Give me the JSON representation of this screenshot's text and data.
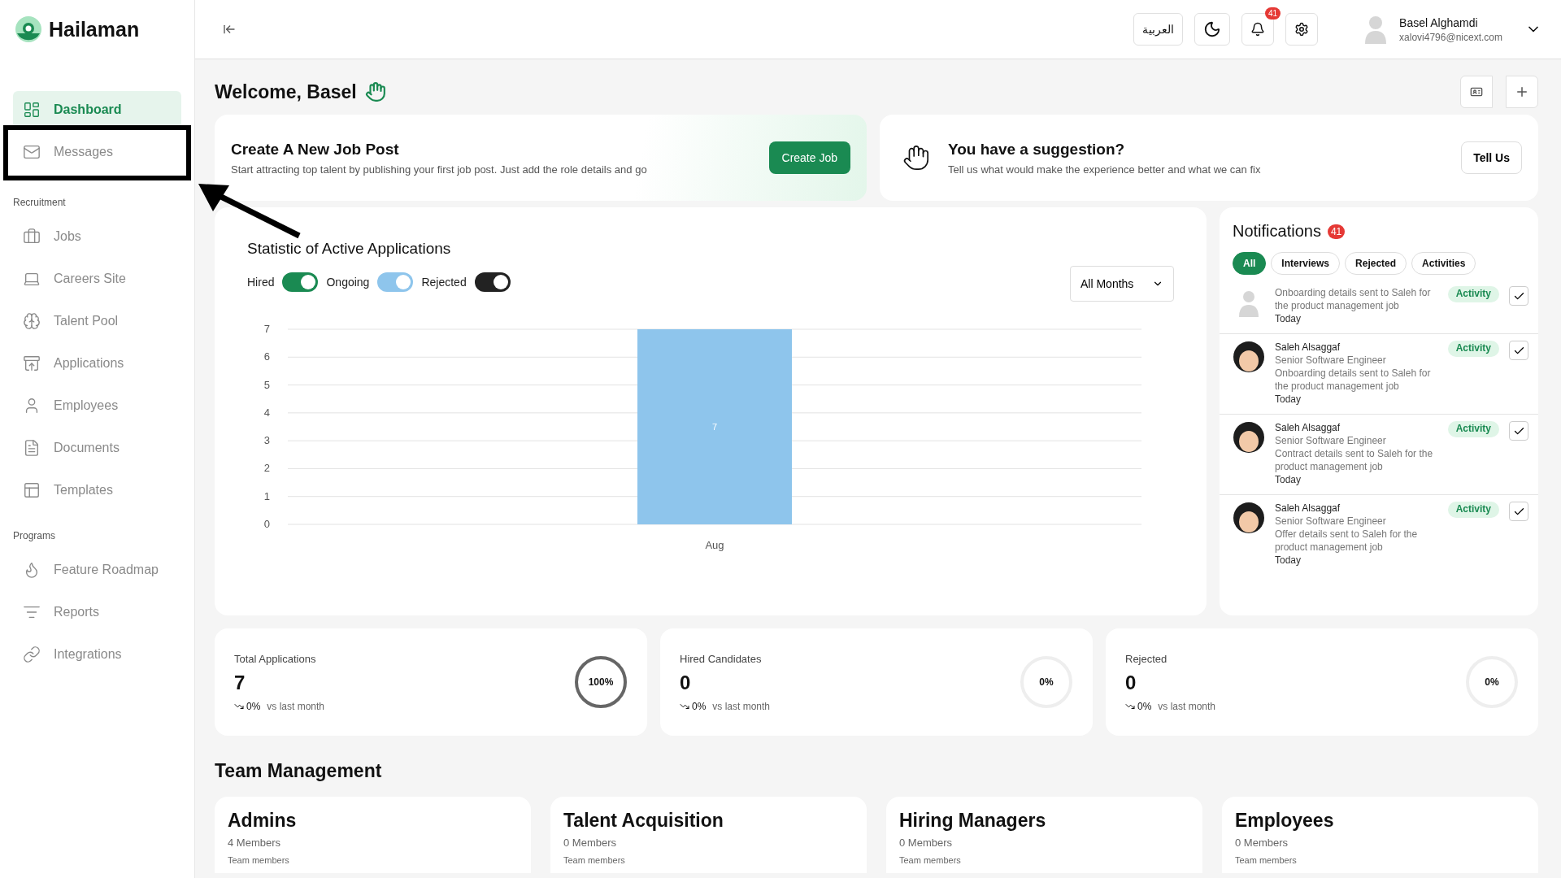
{
  "brand": {
    "name": "Hailaman"
  },
  "sidebar": {
    "sections": [
      {
        "items": [
          {
            "label": "Dashboard",
            "selected": true,
            "highlighted": false
          },
          {
            "label": "Messages",
            "selected": false,
            "highlighted": true
          }
        ]
      },
      {
        "title": "Recruitment",
        "items": [
          {
            "label": "Jobs",
            "selected": false,
            "highlighted": false
          },
          {
            "label": "Careers Site",
            "selected": false,
            "highlighted": false
          },
          {
            "label": "Talent Pool",
            "selected": false,
            "highlighted": false
          },
          {
            "label": "Applications",
            "selected": false,
            "highlighted": false
          },
          {
            "label": "Employees",
            "selected": false,
            "highlighted": false
          },
          {
            "label": "Documents",
            "selected": false,
            "highlighted": false
          },
          {
            "label": "Templates",
            "selected": false,
            "highlighted": false
          }
        ]
      },
      {
        "title": "Programs",
        "items": [
          {
            "label": "Feature Roadmap",
            "selected": false,
            "highlighted": false
          },
          {
            "label": "Reports",
            "selected": false,
            "highlighted": false
          },
          {
            "label": "Integrations",
            "selected": false,
            "highlighted": false
          }
        ]
      }
    ]
  },
  "topbar": {
    "language": "العربية",
    "notification_count": "41",
    "user": {
      "name": "Basel Alghamdi",
      "email": "xalovi4796@nicext.com"
    }
  },
  "welcome": "Welcome, Basel",
  "job_post": {
    "title": "Create A New Job Post",
    "text": "Start attracting top talent by publishing your first job post. Just add the role details and go",
    "button": "Create Job"
  },
  "suggestion": {
    "title": "You have a suggestion?",
    "text": "Tell us what would make the experience better and what we can fix",
    "button": "Tell Us"
  },
  "statistics": {
    "title": "Statistic of Active Applications",
    "toggles": [
      {
        "label": "Hired",
        "on": true,
        "color": "#1a8a52"
      },
      {
        "label": "Ongoing",
        "on": true,
        "color": "#8ec5ec"
      },
      {
        "label": "Rejected",
        "on": true,
        "color": "#222222"
      }
    ],
    "period": "All Months",
    "chart_data": {
      "type": "bar",
      "categories": [
        "Aug"
      ],
      "series": [
        {
          "color": "#8ec5ec",
          "values": [
            7
          ]
        }
      ],
      "ylim": [
        0,
        7
      ],
      "yticks": [
        0,
        1,
        2,
        3,
        4,
        5,
        6,
        7
      ],
      "grid": true,
      "data_labels": true
    }
  },
  "notifications": {
    "title": "Notifications",
    "count": "41",
    "filters": [
      {
        "label": "All",
        "selected": true
      },
      {
        "label": "Interviews",
        "selected": false
      },
      {
        "label": "Rejected",
        "selected": false
      },
      {
        "label": "Activities",
        "selected": false
      }
    ],
    "items": [
      {
        "kind": "placeholder",
        "text": "Onboarding details sent to Saleh for the product management job",
        "time": "Today",
        "tag": "Activity"
      },
      {
        "kind": "person",
        "name": "Saleh Alsaggaf",
        "role": "Senior Software Engineer",
        "text": "Onboarding details sent to Saleh for the product management job",
        "time": "Today",
        "tag": "Activity"
      },
      {
        "kind": "person",
        "name": "Saleh Alsaggaf",
        "role": "Senior Software Engineer",
        "text": "Contract details sent to Saleh for the product management job",
        "time": "Today",
        "tag": "Activity"
      },
      {
        "kind": "person",
        "name": "Saleh Alsaggaf",
        "role": "Senior Software Engineer",
        "text": "Offer details sent to Saleh for the product management job",
        "time": "Today",
        "tag": "Activity"
      }
    ]
  },
  "stats": [
    {
      "label": "Total Applications",
      "value": "7",
      "change": "0%",
      "comparison": "vs last month",
      "percent": "100%",
      "level": 1
    },
    {
      "label": "Hired Candidates",
      "value": "0",
      "change": "0%",
      "comparison": "vs last month",
      "percent": "0%"
    },
    {
      "label": "Rejected",
      "value": "0",
      "change": "0%",
      "comparison": "vs last month",
      "percent": "0%"
    }
  ],
  "team_management": {
    "title": "Team Management",
    "teams": [
      {
        "name": "Admins",
        "members": "4 Members",
        "caption": "Team members"
      },
      {
        "name": "Talent Acquisition",
        "members": "0 Members",
        "caption": "Team members"
      },
      {
        "name": "Hiring Managers",
        "members": "0 Members",
        "caption": "Team members"
      },
      {
        "name": "Employees",
        "members": "0 Members",
        "caption": "Team members"
      }
    ]
  }
}
